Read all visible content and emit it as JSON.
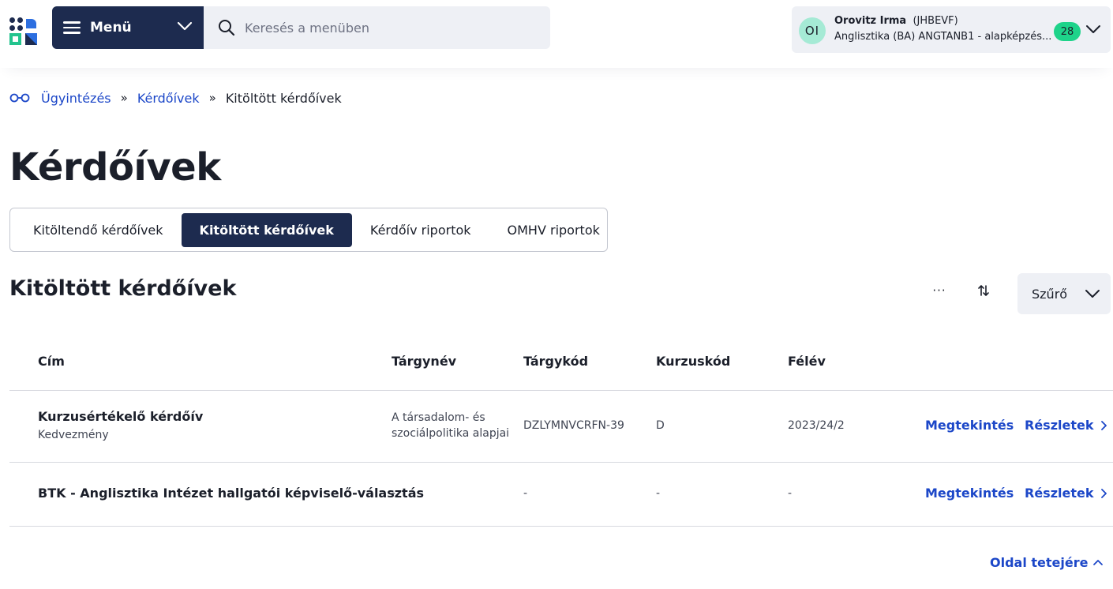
{
  "header": {
    "menu_label": "Menü",
    "search_placeholder": "Keresés a menüben",
    "user": {
      "initials": "OI",
      "name": "Orovitz Irma",
      "code": "(JHBEVF)",
      "program": "Anglisztika (BA) ANGTANB1 - alapképzés...",
      "notifications": "28"
    }
  },
  "breadcrumb": {
    "items": [
      "Ügyintézés",
      "Kérdőívek"
    ],
    "current": "Kitöltött kérdőívek",
    "separator": "»"
  },
  "page_title": "Kérdőívek",
  "tabs": [
    {
      "label": "Kitöltendő kérdőívek",
      "active": false
    },
    {
      "label": "Kitöltött kérdőívek",
      "active": true
    },
    {
      "label": "Kérdőív riportok",
      "active": false
    },
    {
      "label": "OMHV riportok",
      "active": false
    }
  ],
  "section": {
    "title": "Kitöltött kérdőívek",
    "more_label": "···",
    "filter_label": "Szűrő"
  },
  "table": {
    "headers": [
      "Cím",
      "Tárgynév",
      "Tárgykód",
      "Kurzuskód",
      "Félév"
    ],
    "rows": [
      {
        "title": "Kurzusértékelő kérdőív",
        "subtitle": "Kedvezmény",
        "subject_line1": "A társadalom- és",
        "subject_line2": "szociálpolitika alapjai",
        "subject_code": "DZLYMNVCRFN-39",
        "course_code": "D",
        "semester": "2023/24/2",
        "view_label": "Megtekintés",
        "details_label": "Részletek"
      },
      {
        "title": "BTK - Anglisztika Intézet hallgatói képviselő-választás",
        "subject": "-",
        "subject_code": "-",
        "course_code": "-",
        "semester": "-",
        "view_label": "Megtekintés",
        "details_label": "Részletek"
      }
    ]
  },
  "footer": {
    "to_top_label": "Oldal tetejére"
  },
  "colors": {
    "navy": "#1d2b4f",
    "link": "#1c47c8",
    "badge": "#1ed38a",
    "avatar": "#a5ead5",
    "panel": "#eef0f5"
  }
}
